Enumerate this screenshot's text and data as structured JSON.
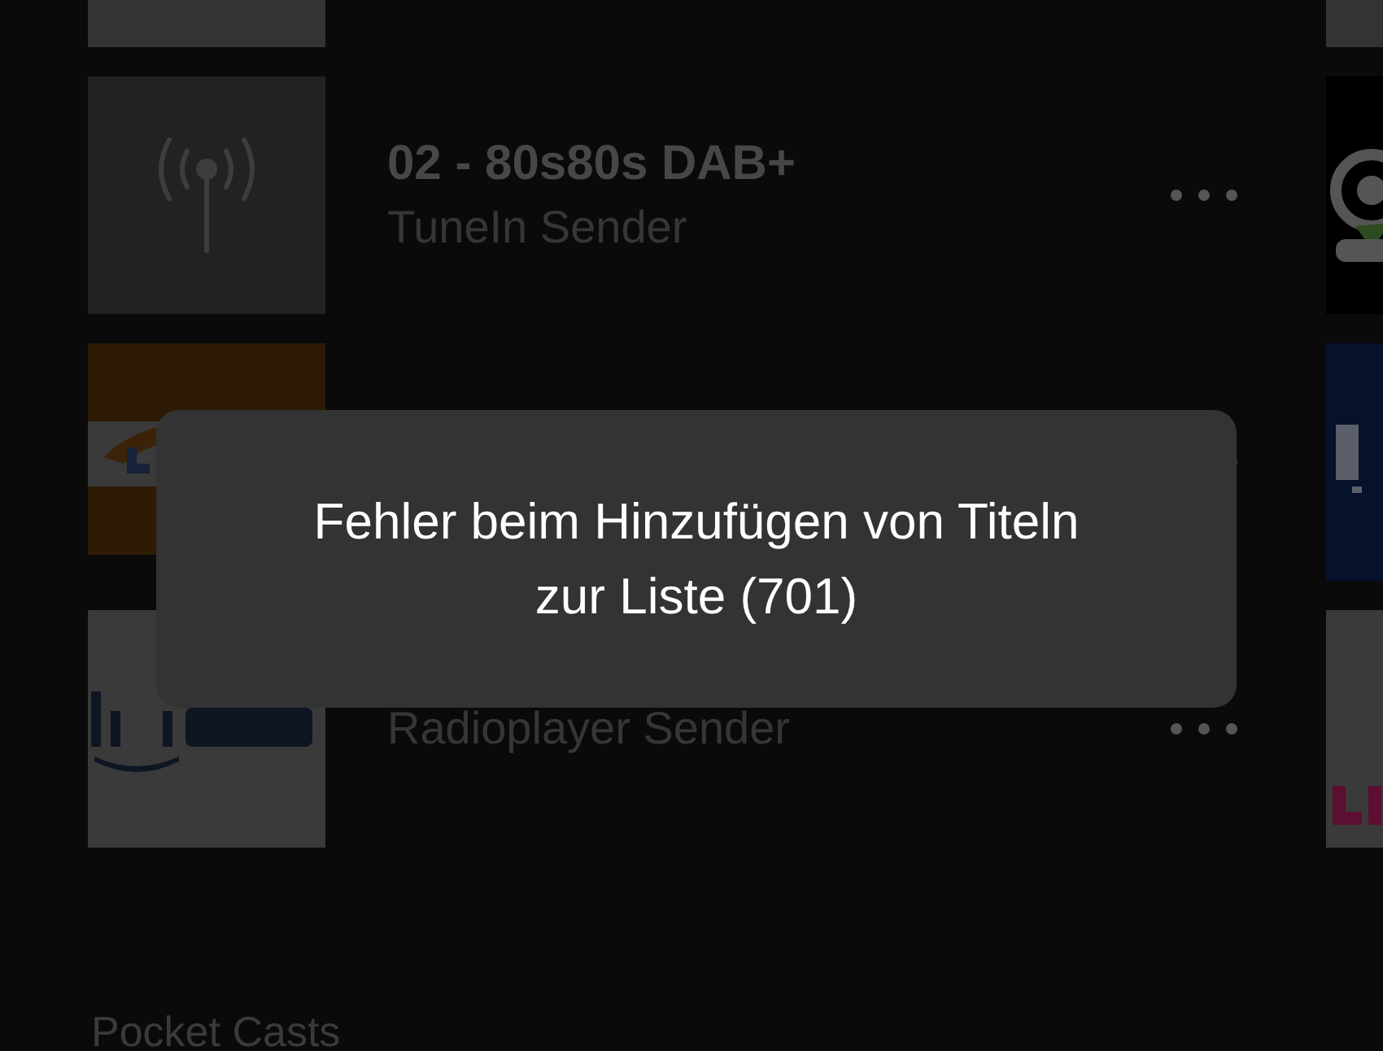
{
  "stations": [
    {
      "kind": "cut",
      "artwork": {
        "kind": "blank"
      }
    },
    {
      "kind": "station",
      "title": "02 - 80s80s DAB+",
      "subtitle": "TuneIn Sender",
      "artwork": {
        "kind": "placeholder"
      }
    },
    {
      "kind": "station",
      "artwork": {
        "kind": "picture"
      }
    },
    {
      "kind": "station",
      "subtitle": "Radioplayer Sender",
      "artwork": {
        "kind": "picture"
      }
    }
  ],
  "side_artwork": [
    {
      "kind": "blank"
    },
    {
      "kind": "picture"
    },
    {
      "kind": "picture"
    },
    {
      "kind": "picture"
    }
  ],
  "section_title": "Pocket Casts",
  "toast": {
    "message": "Fehler beim Hinzufügen von Titeln zur Liste (701)"
  }
}
